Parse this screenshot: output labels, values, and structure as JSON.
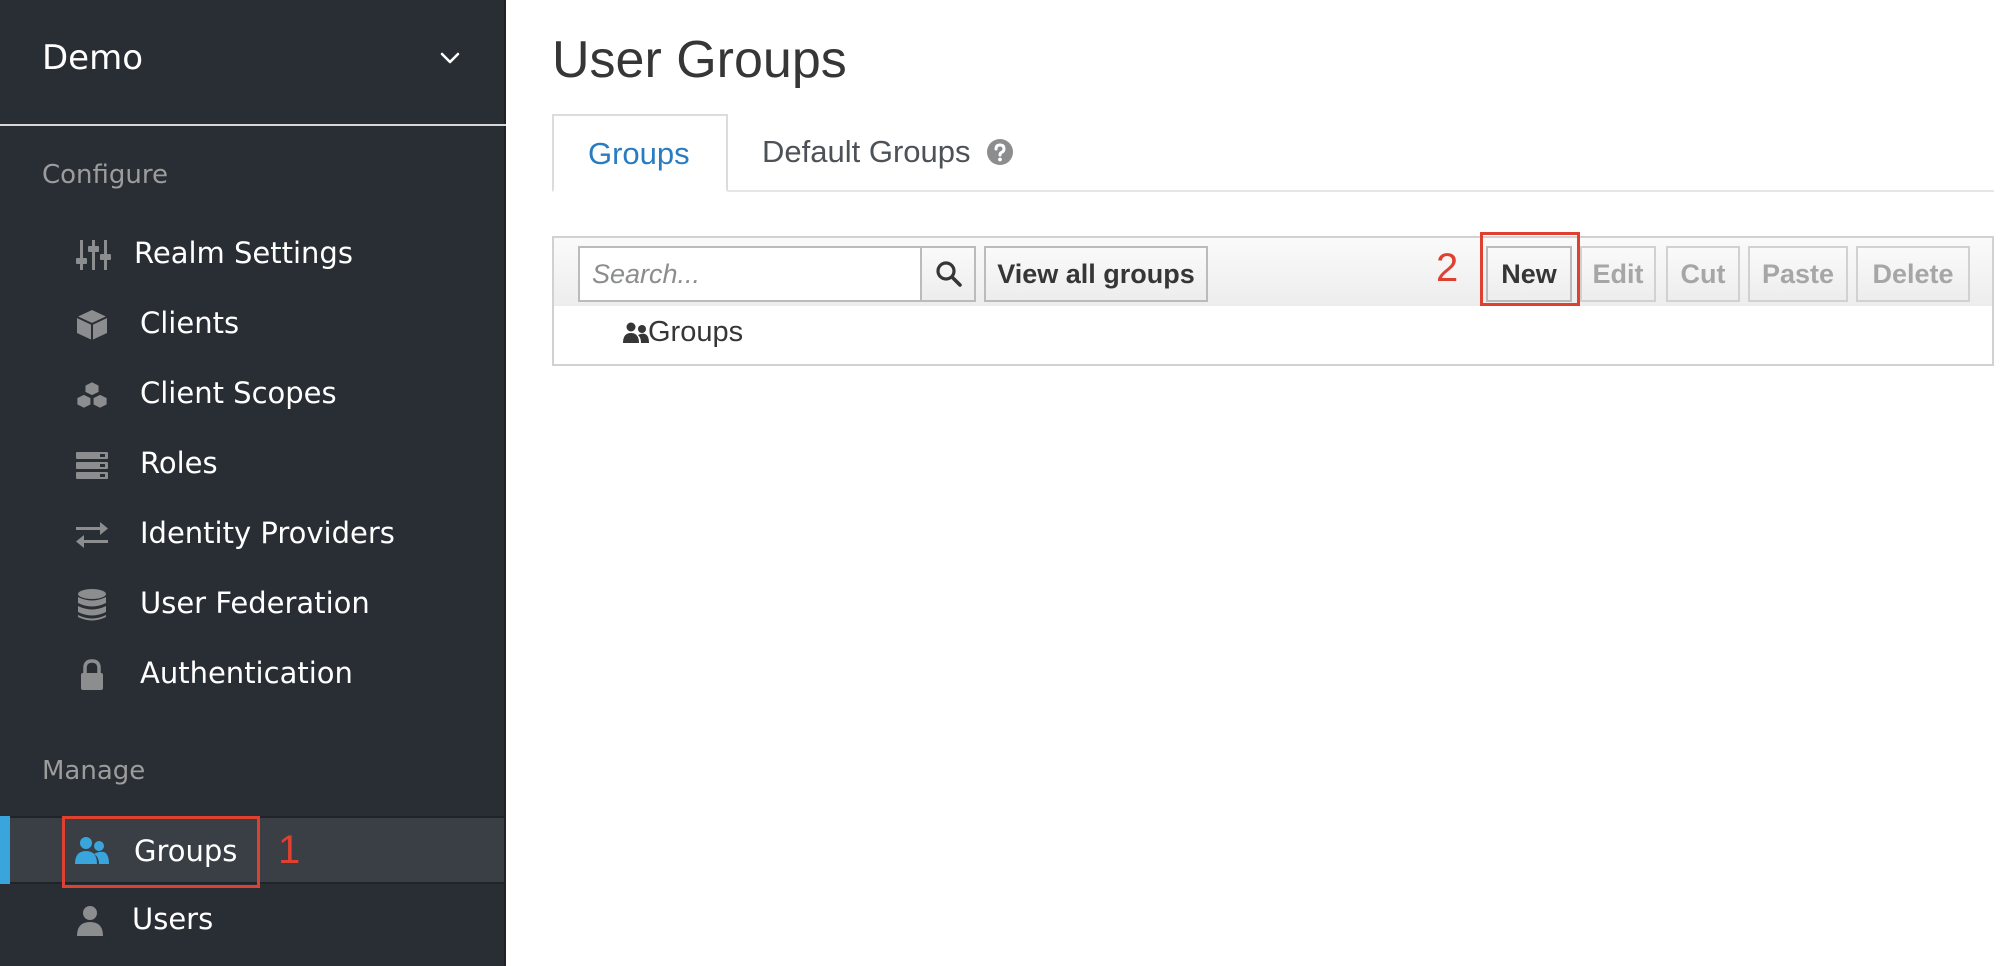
{
  "sidebar": {
    "realm_name": "Demo",
    "configure_label": "Configure",
    "manage_label": "Manage",
    "configure_items": [
      {
        "label": "Realm Settings",
        "icon": "sliders-icon"
      },
      {
        "label": "Clients",
        "icon": "cube-icon"
      },
      {
        "label": "Client Scopes",
        "icon": "cubes-icon"
      },
      {
        "label": "Roles",
        "icon": "list-icon"
      },
      {
        "label": "Identity Providers",
        "icon": "exchange-icon"
      },
      {
        "label": "User Federation",
        "icon": "database-icon"
      },
      {
        "label": "Authentication",
        "icon": "lock-icon"
      }
    ],
    "manage_items": [
      {
        "label": "Groups",
        "icon": "users-icon",
        "active": true
      },
      {
        "label": "Users",
        "icon": "user-icon",
        "active": false
      }
    ]
  },
  "main": {
    "title": "User Groups",
    "tabs": [
      {
        "label": "Groups",
        "active": true
      },
      {
        "label": "Default Groups",
        "active": false
      }
    ],
    "toolbar": {
      "search_placeholder": "Search...",
      "view_all_label": "View all groups",
      "new_label": "New",
      "edit_label": "Edit",
      "cut_label": "Cut",
      "paste_label": "Paste",
      "delete_label": "Delete"
    },
    "tree": {
      "root_label": "Groups"
    }
  },
  "annotations": {
    "step1": "1",
    "step2": "2"
  },
  "colors": {
    "sidebar_bg": "#292e34",
    "active_accent": "#39a5dc",
    "tab_active_text": "#2a7cc1",
    "annotation": "#e0402f"
  }
}
